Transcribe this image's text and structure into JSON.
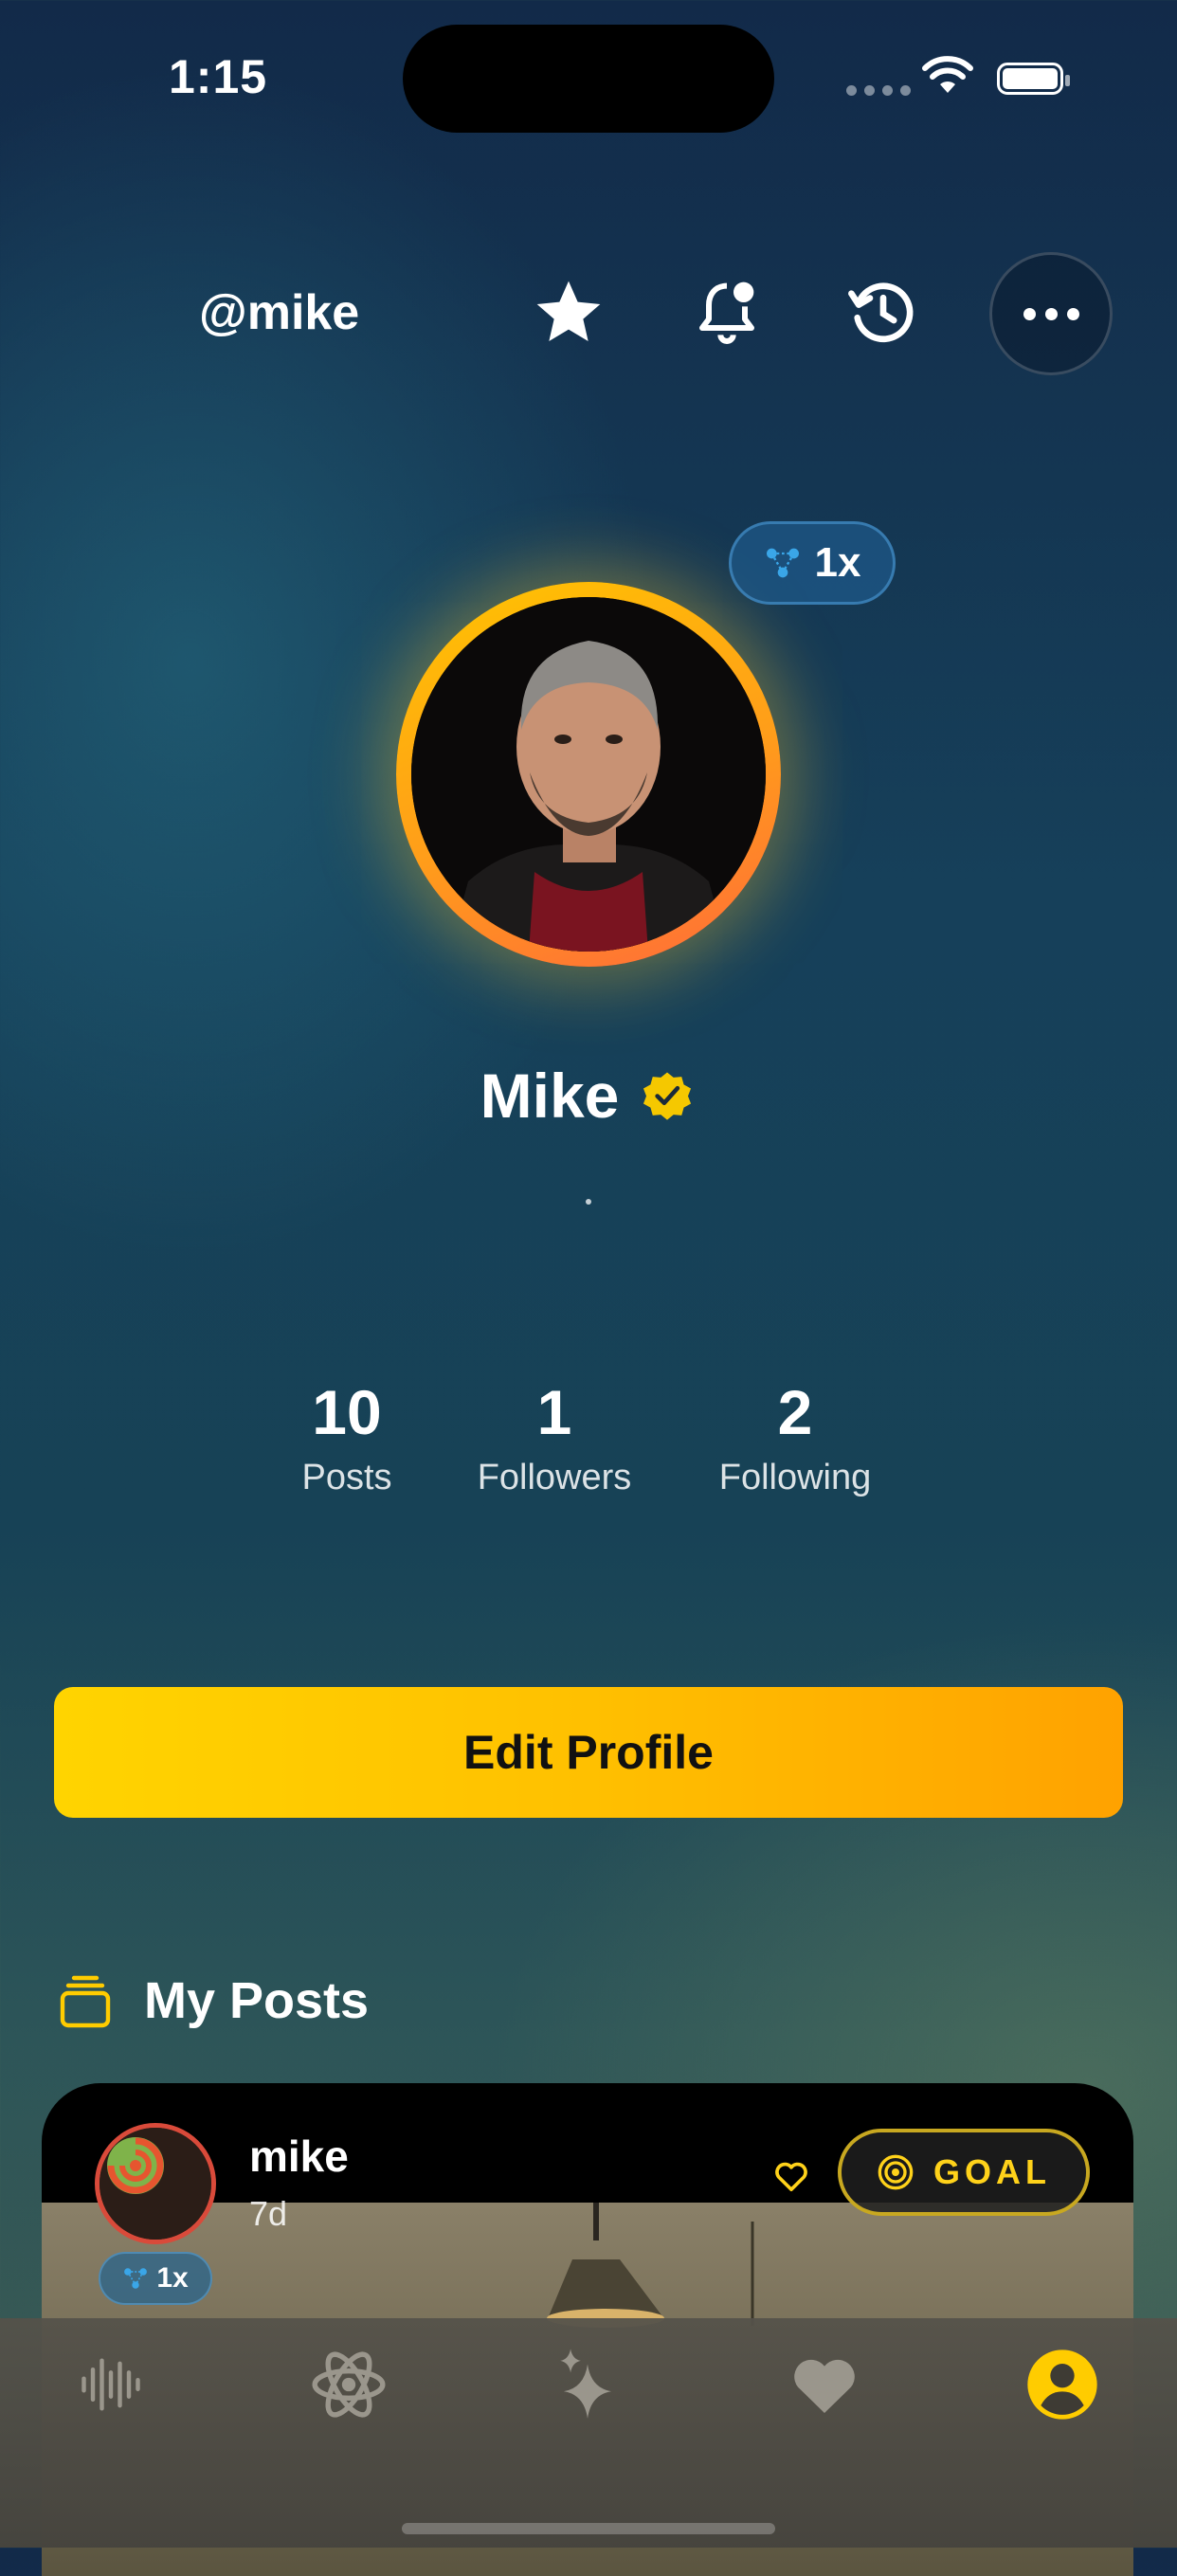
{
  "status_bar": {
    "time": "1:15"
  },
  "header": {
    "handle": "@mike",
    "icons": [
      "star-icon",
      "bell-icon",
      "history-icon",
      "more-icon"
    ]
  },
  "profile": {
    "name": "Mike",
    "verified": true,
    "boost_badge": "1x",
    "bio": "."
  },
  "stats": [
    {
      "value": "10",
      "label": "Posts"
    },
    {
      "value": "1",
      "label": "Followers"
    },
    {
      "value": "2",
      "label": "Following"
    }
  ],
  "edit_button": "Edit Profile",
  "posts_section": {
    "title": "My Posts"
  },
  "post": {
    "user": "mike",
    "age": "7d",
    "boost": "1x",
    "goal_label": "GOAL"
  },
  "tabbar": {
    "items": [
      "waveform-icon",
      "atom-icon",
      "sparkles-icon",
      "heart-icon",
      "profile-icon"
    ],
    "active_index": 4
  },
  "colors": {
    "accent": "#ffc400",
    "accent_end": "#ffa200",
    "verified": "#f5c800",
    "goal_text": "#ffd21a"
  }
}
